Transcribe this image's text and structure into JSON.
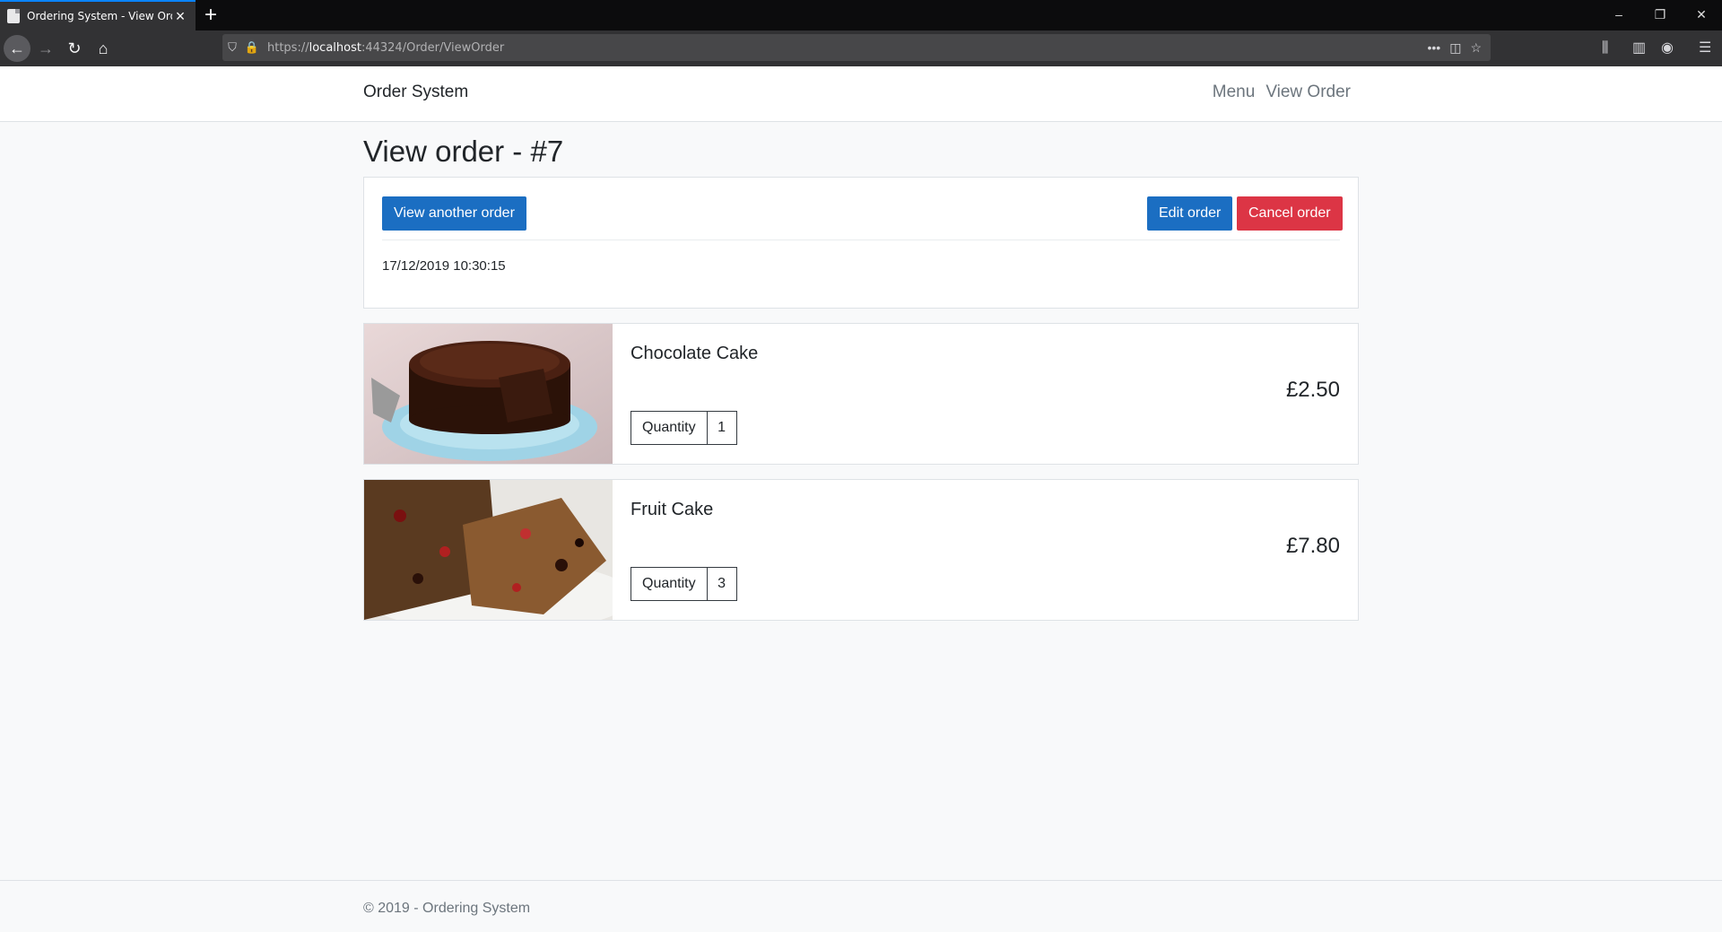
{
  "browser": {
    "tab_title": "Ordering System - View Order",
    "url_prefix": "https://",
    "url_host": "localhost",
    "url_rest": ":44324/Order/ViewOrder"
  },
  "header": {
    "brand": "Order System",
    "nav": [
      "Menu",
      "View Order"
    ]
  },
  "page": {
    "title": "View order - #7"
  },
  "order": {
    "view_another_label": "View another order",
    "edit_label": "Edit order",
    "cancel_label": "Cancel order",
    "date": "17/12/2019 10:30:15"
  },
  "items": [
    {
      "name": "Chocolate Cake",
      "price": "£2.50",
      "quantity_label": "Quantity",
      "quantity": "1"
    },
    {
      "name": "Fruit Cake",
      "price": "£7.80",
      "quantity_label": "Quantity",
      "quantity": "3"
    }
  ],
  "footer": {
    "text": "© 2019 - Ordering System"
  },
  "colors": {
    "primary": "#1b6ec2",
    "danger": "#dc3545"
  }
}
